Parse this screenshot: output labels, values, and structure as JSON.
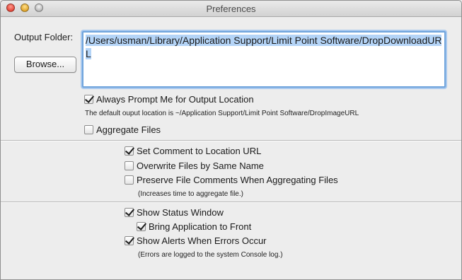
{
  "window": {
    "title": "Preferences"
  },
  "output": {
    "label": "Output Folder:",
    "browse_label": "Browse...",
    "path_value": "/Users/usman/Library/Application Support/Limit Point Software/DropDownloadURL"
  },
  "options": {
    "always_prompt": {
      "label": "Always Prompt Me for Output Location",
      "checked": true
    },
    "default_note": "The default ouput location is ~/Application Support/Limit Point Software/DropImageURL",
    "aggregate_files": {
      "label": "Aggregate Files",
      "checked": false
    }
  },
  "file_options": {
    "set_comment": {
      "label": "Set Comment to Location URL",
      "checked": true
    },
    "overwrite_files": {
      "label": "Overwrite Files by Same Name",
      "checked": false
    },
    "preserve_comments": {
      "label": "Preserve File Comments When Aggregating Files",
      "checked": false
    },
    "aggregate_note": "(Increases time to aggregate file.)"
  },
  "window_options": {
    "show_status": {
      "label": "Show Status Window",
      "checked": true
    },
    "bring_to_front": {
      "label": "Bring Application to Front",
      "checked": true
    },
    "show_alerts": {
      "label": "Show Alerts When Errors Occur",
      "checked": true
    },
    "errors_note": "(Errors are logged to the system Console log.)"
  },
  "colors": {
    "focus_ring": "#6fa4dc",
    "selection": "#b4d4f7",
    "background": "#ededed"
  }
}
